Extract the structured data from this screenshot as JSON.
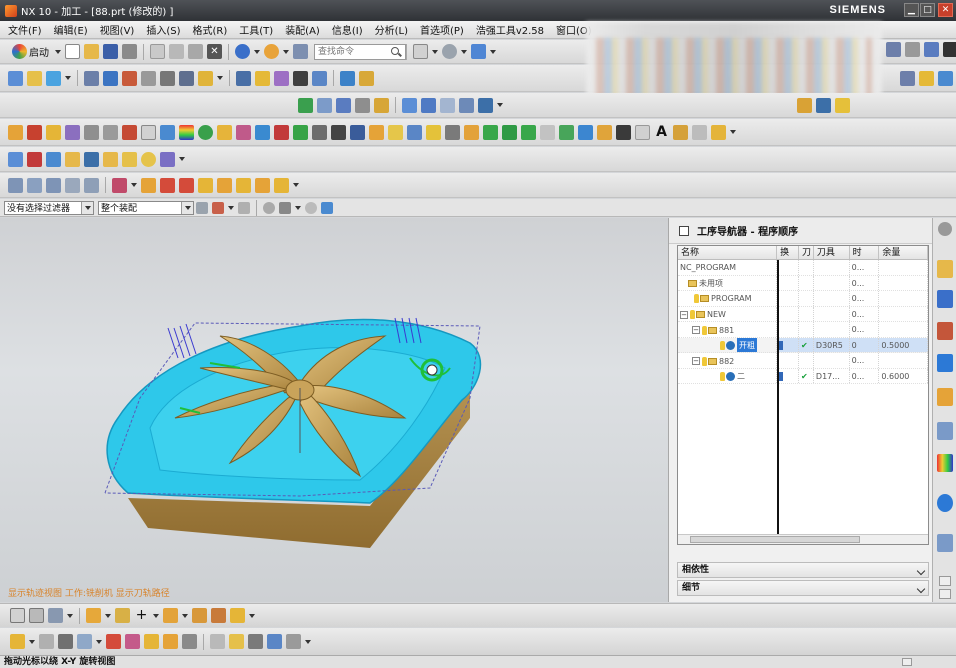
{
  "window": {
    "title": "NX 10 - 加工 - [88.prt (修改的) ]",
    "brand": "SIEMENS"
  },
  "menu": [
    "文件(F)",
    "编辑(E)",
    "视图(V)",
    "插入(S)",
    "格式(R)",
    "工具(T)",
    "装配(A)",
    "信息(I)",
    "分析(L)",
    "首选项(P)",
    "浩强工具v2.58",
    "窗口(O)"
  ],
  "toolbar": {
    "start_label": "启动",
    "search_placeholder": "查找命令"
  },
  "filterbar": {
    "selection_filter": "没有选择过滤器",
    "assembly_scope": "整个装配"
  },
  "navigator": {
    "title": "工序导航器 - 程序顺序",
    "columns": [
      "名称",
      "换",
      "刀",
      "刀具",
      "时",
      "余量"
    ],
    "rows": [
      {
        "name": "NC_PROGRAM",
        "change": "",
        "path": "",
        "tool": "",
        "time": "0...",
        "stock": ""
      },
      {
        "name": "未用项",
        "change": "",
        "path": "",
        "tool": "",
        "time": "0...",
        "stock": ""
      },
      {
        "name": "PROGRAM",
        "change": "",
        "path": "",
        "tool": "",
        "time": "0...",
        "stock": ""
      },
      {
        "name": "NEW",
        "change": "",
        "path": "",
        "tool": "",
        "time": "0...",
        "stock": ""
      },
      {
        "name": "881",
        "change": "",
        "path": "",
        "tool": "",
        "time": "0...",
        "stock": ""
      },
      {
        "name": "开粗",
        "change": "",
        "path": "",
        "tool": "D30R5",
        "time": "0",
        "stock": "0.5000"
      },
      {
        "name": "882",
        "change": "",
        "path": "",
        "tool": "",
        "time": "0...",
        "stock": ""
      },
      {
        "name": "二",
        "change": "",
        "path": "✔",
        "tool": "D17...",
        "time": "0...",
        "stock": "0.6000"
      }
    ],
    "dependencies_label": "相依性",
    "details_label": "细节"
  },
  "viewport": {
    "overlay_text": "显示轨迹视图 工作:铣削机 显示刀轨路径"
  },
  "statusbar": {
    "text": "拖动光标以绕 X-Y 旋转视图"
  },
  "colors": {
    "titlebar": "#3a3d42",
    "part_tan": "#c8a05a",
    "toolpath_cyan": "#2ec8ea",
    "selection_blue": "#2c79d6",
    "close_red": "#c8402b"
  }
}
